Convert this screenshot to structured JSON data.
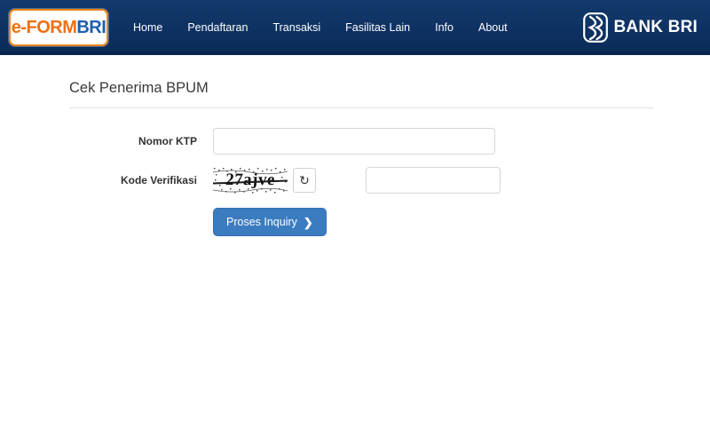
{
  "header": {
    "logo": {
      "part1": "e-FORM",
      "part2": "BRI"
    },
    "nav_items": [
      {
        "label": "Home"
      },
      {
        "label": "Pendaftaran"
      },
      {
        "label": "Transaksi"
      },
      {
        "label": "Fasilitas Lain"
      },
      {
        "label": "Info"
      },
      {
        "label": "About"
      }
    ],
    "brand": {
      "name": "BANK BRI",
      "mark_icon": "bri-logo-icon"
    },
    "background_color": "#0e3162",
    "logo_border_color": "#e8851f",
    "logo_text_color": "#ef7012",
    "logo_accent_color": "#1d5fad"
  },
  "main": {
    "page_title": "Cek Penerima BPUM",
    "fields": [
      {
        "label": "Nomor KTP",
        "value": "",
        "placeholder": ""
      },
      {
        "label": "Kode Verifikasi",
        "value": "",
        "placeholder": ""
      }
    ],
    "captcha": {
      "code_text": "27ajve",
      "refresh_icon": "refresh-icon",
      "refresh_glyph": "↻"
    },
    "submit": {
      "label": "Proses Inquiry",
      "chevron": "❯",
      "color": "#3b7cc0"
    }
  }
}
